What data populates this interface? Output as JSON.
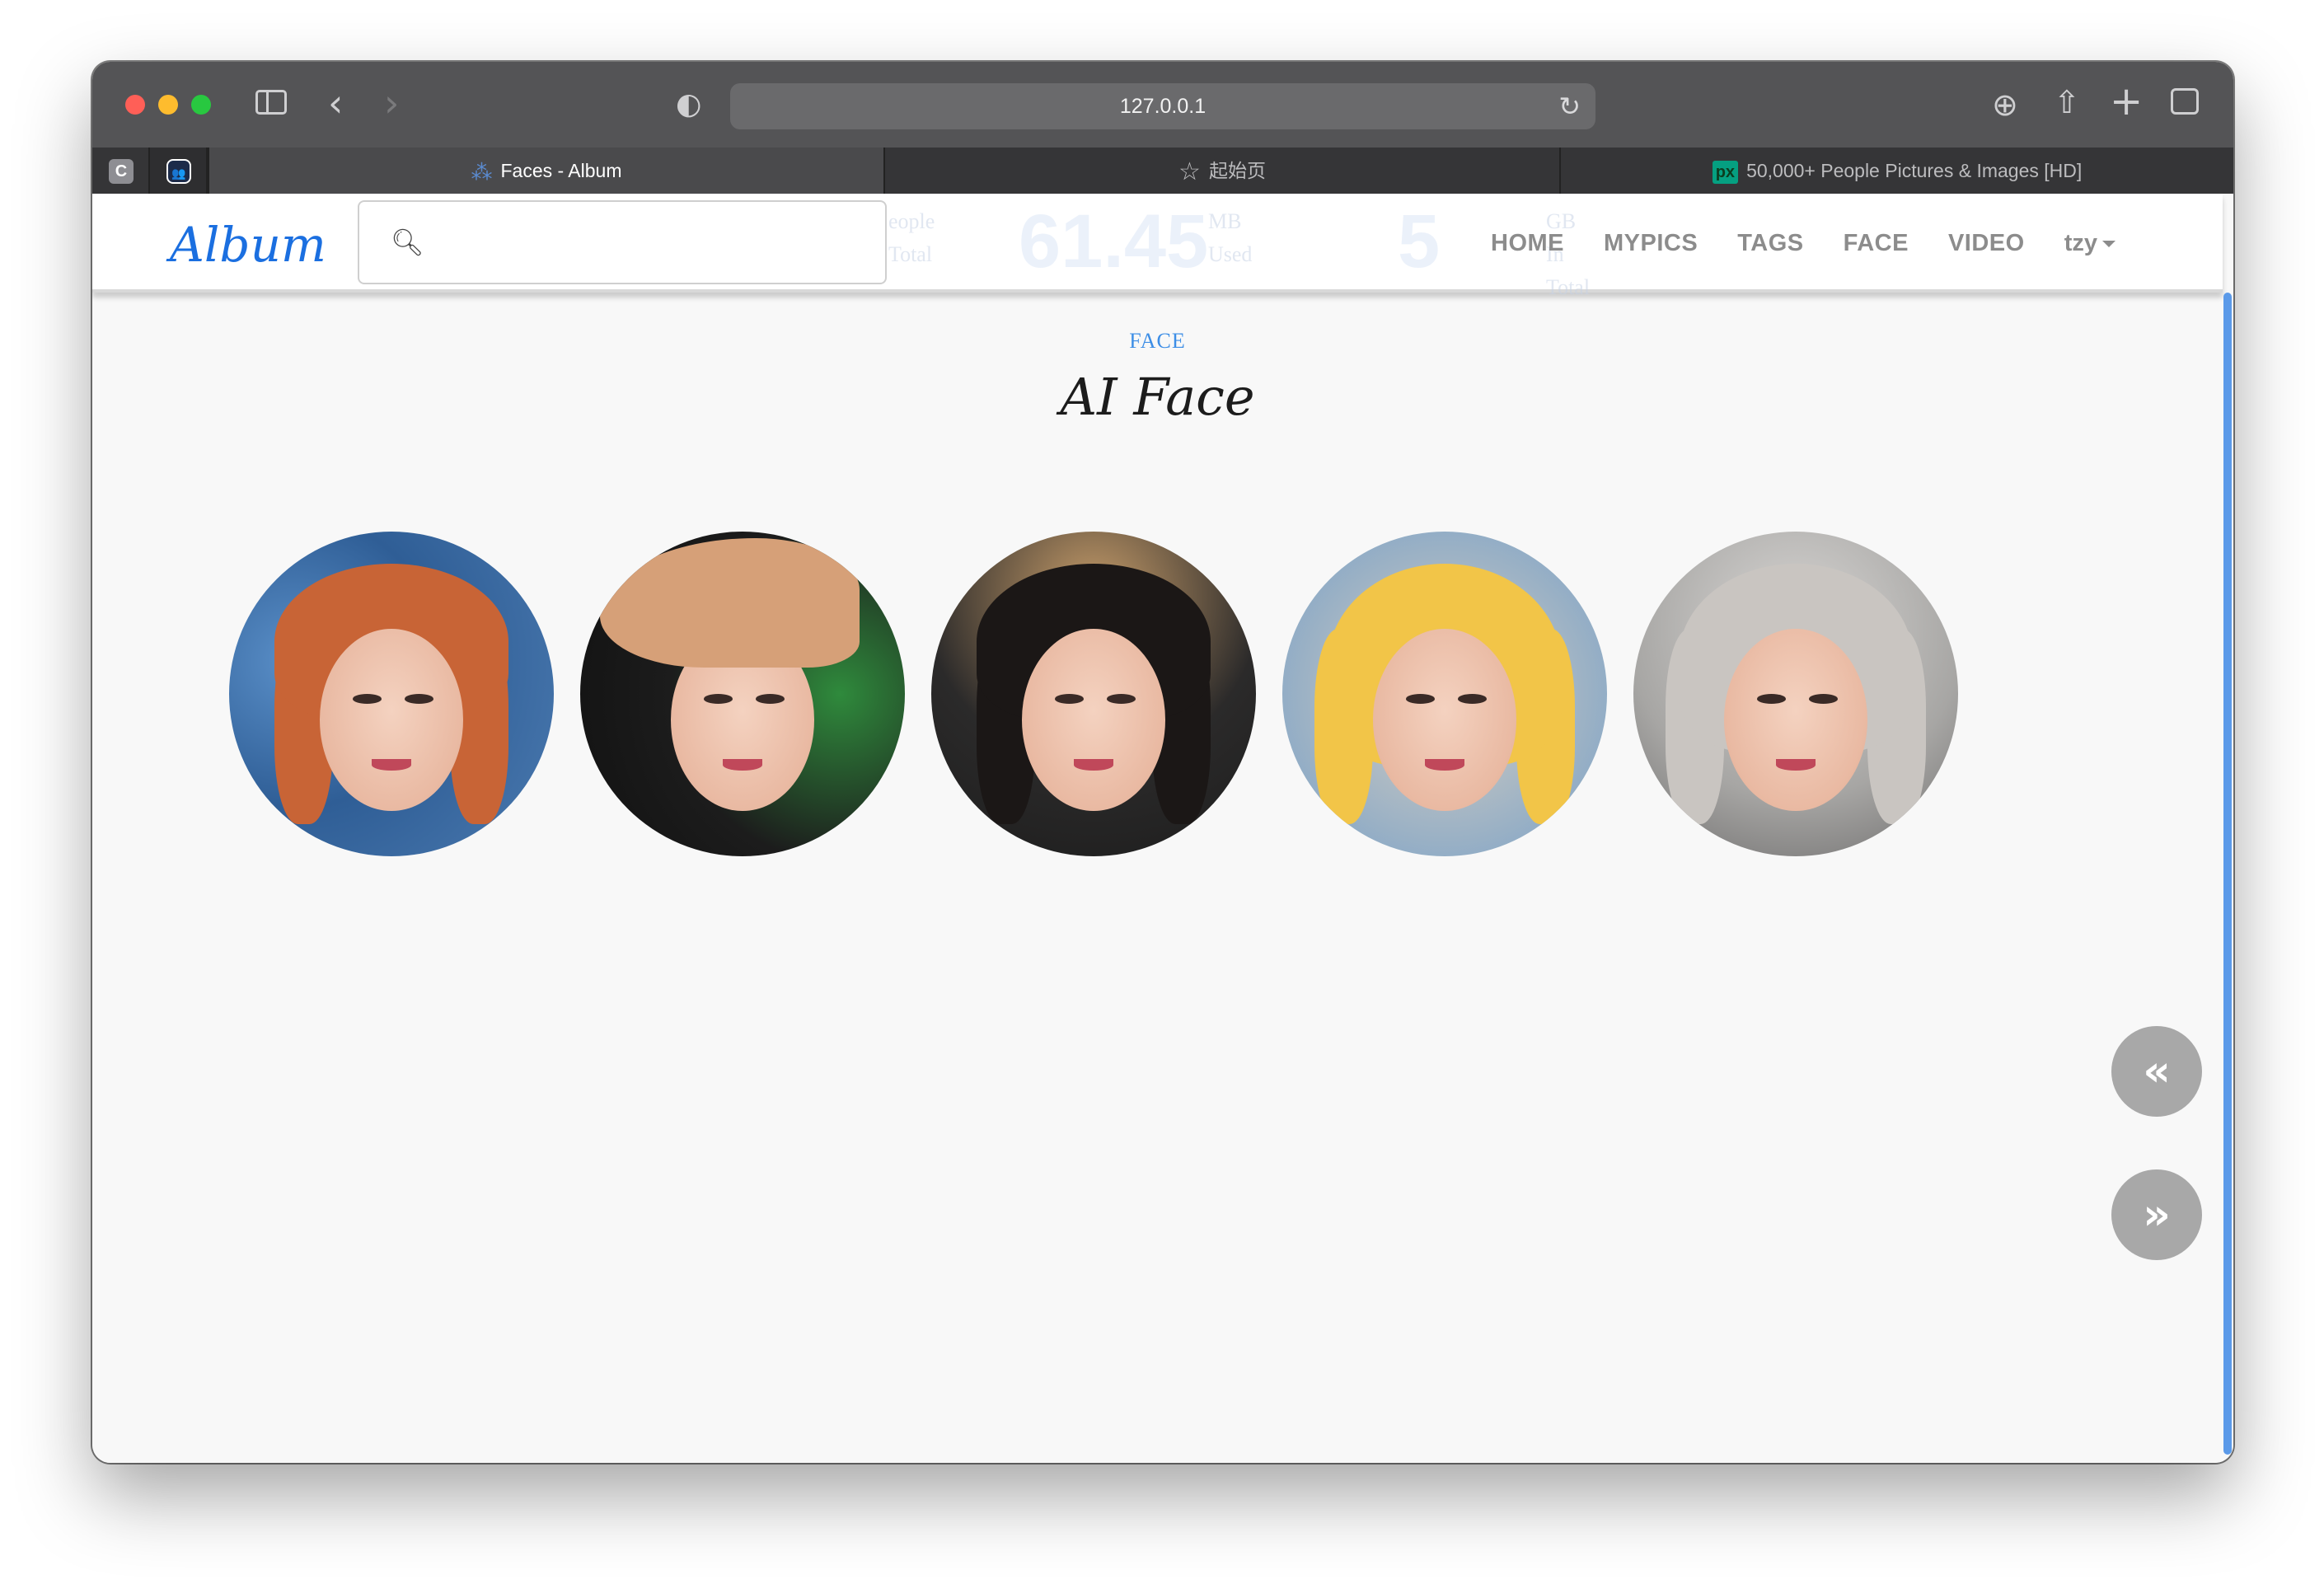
{
  "browser": {
    "url": "127.0.0.1",
    "tabs": [
      {
        "label": "Faces - Album",
        "active": true,
        "favicon": "dots-grid-icon"
      },
      {
        "label": "起始页",
        "active": false,
        "favicon": "star-icon"
      },
      {
        "label": "50,000+ People Pictures & Images [HD]",
        "active": false,
        "favicon": "px-icon",
        "favicon_text": "px"
      }
    ],
    "pinned_tabs": [
      {
        "label": "C"
      },
      {
        "label": "👥"
      }
    ]
  },
  "navbar": {
    "brand": "Album",
    "search_placeholder": "",
    "links": [
      "HOME",
      "MYPICS",
      "TAGS",
      "FACE",
      "VIDEO"
    ],
    "user": "tzy",
    "ghost_stats": {
      "people_label_1": "eople",
      "people_label_2": "Total",
      "mb_value": "61.45",
      "mb_label_1": "MB",
      "mb_label_2": "Used",
      "gb_value": "5",
      "gb_label_1": "GB",
      "gb_label_2": "In Total"
    }
  },
  "main": {
    "section_label": "FACE",
    "title": "AI Face",
    "faces": [
      {
        "name": "face-1"
      },
      {
        "name": "face-2"
      },
      {
        "name": "face-3"
      },
      {
        "name": "face-4"
      },
      {
        "name": "face-5"
      }
    ],
    "pager": {
      "prev": "«",
      "next": "»"
    }
  },
  "colors": {
    "brand": "#1b6fe0",
    "nav_text": "#8c8c8c",
    "section_label": "#3d8ee6",
    "pager_bg": "#a8a8a8",
    "scrollbar": "#5b9ae9"
  }
}
